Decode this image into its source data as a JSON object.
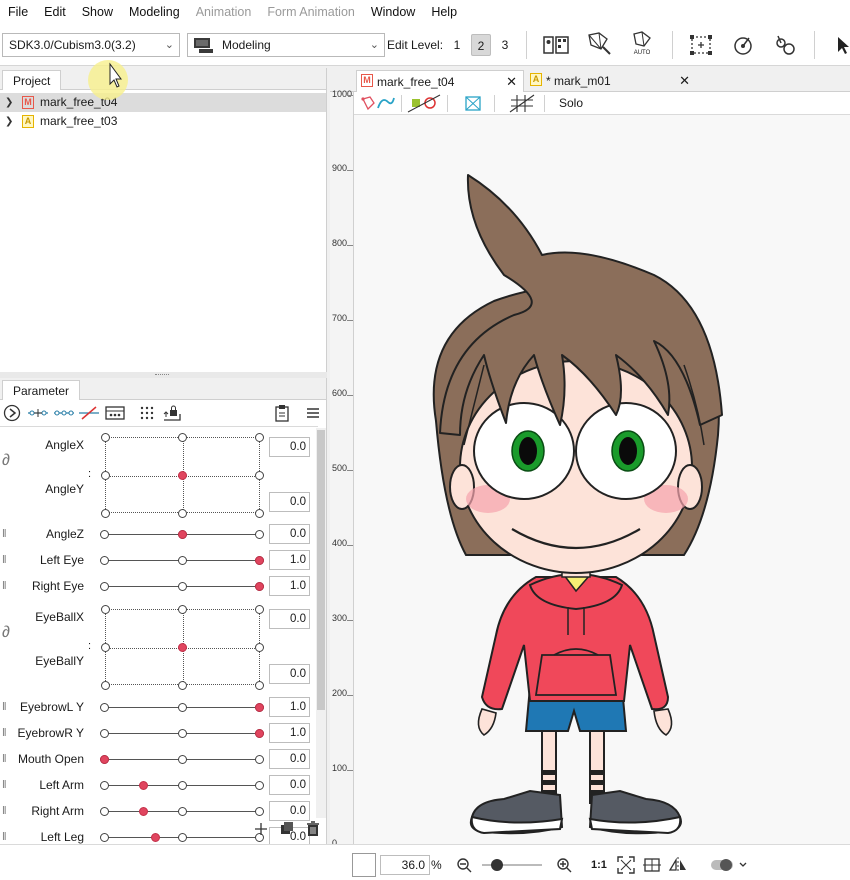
{
  "menu": {
    "items": [
      {
        "label": "File",
        "enabled": true
      },
      {
        "label": "Edit",
        "enabled": true
      },
      {
        "label": "Show",
        "enabled": true
      },
      {
        "label": "Modeling",
        "enabled": true
      },
      {
        "label": "Animation",
        "enabled": false
      },
      {
        "label": "Form Animation",
        "enabled": false
      },
      {
        "label": "Window",
        "enabled": true
      },
      {
        "label": "Help",
        "enabled": true
      }
    ]
  },
  "toolbar": {
    "sdk_select": "SDK3.0/Cubism3.0(3.2)",
    "mode_select": "Modeling",
    "edit_level_label": "Edit Level:",
    "edit_levels": [
      "1",
      "2",
      "3"
    ],
    "edit_level_active": "2",
    "auto_label": "AUTO"
  },
  "project": {
    "tab": "Project",
    "items": [
      {
        "name": "mark_free_t04",
        "badge": "M",
        "badge_color": "#e8584a",
        "selected": true
      },
      {
        "name": "mark_free_t03",
        "badge": "A",
        "badge_color": "#e6b400",
        "selected": false
      }
    ]
  },
  "parameter": {
    "tab": "Parameter",
    "rows_1d": [
      {
        "name": "AngleZ",
        "value": "0.0",
        "fraction": 0.5
      },
      {
        "name": "Left Eye",
        "value": "1.0",
        "fraction": 1.0
      },
      {
        "name": "Right Eye",
        "value": "1.0",
        "fraction": 1.0
      },
      {
        "name": "EyebrowL Y",
        "value": "1.0",
        "fraction": 1.0
      },
      {
        "name": "EyebrowR Y",
        "value": "1.0",
        "fraction": 1.0
      },
      {
        "name": "Mouth Open",
        "value": "0.0",
        "fraction": 0.0
      },
      {
        "name": "Left Arm",
        "value": "0.0",
        "fraction": 0.25
      },
      {
        "name": "Right Arm",
        "value": "0.0",
        "fraction": 0.25
      },
      {
        "name": "Left Leg",
        "value": "0.0",
        "fraction": 0.33
      }
    ],
    "grids_2d": [
      {
        "x_name": "AngleX",
        "y_name": "AngleY",
        "x_value": "0.0",
        "y_value": "0.0"
      },
      {
        "x_name": "EyeBallX",
        "y_name": "EyeBallY",
        "x_value": "0.0",
        "y_value": "0.0"
      }
    ],
    "accent_color": "#e0455f"
  },
  "viewport": {
    "tabs": [
      {
        "label": "mark_free_t04",
        "badge": "M",
        "badge_color": "#e8584a",
        "active": true
      },
      {
        "label": "* mark_m01",
        "badge": "A",
        "badge_color": "#e6b400",
        "active": false
      }
    ],
    "solo_label": "Solo",
    "ruler_labels": [
      "1000",
      "900",
      "800",
      "700",
      "600",
      "500",
      "400",
      "300",
      "200",
      "100",
      "0"
    ]
  },
  "status": {
    "zoom": "36.0",
    "zoom_unit": "%",
    "ratio_label": "1:1",
    "zoom_slider_fraction": 0.25
  },
  "icons": {
    "close": "close-icon",
    "chevron": "chevron-down-icon"
  }
}
